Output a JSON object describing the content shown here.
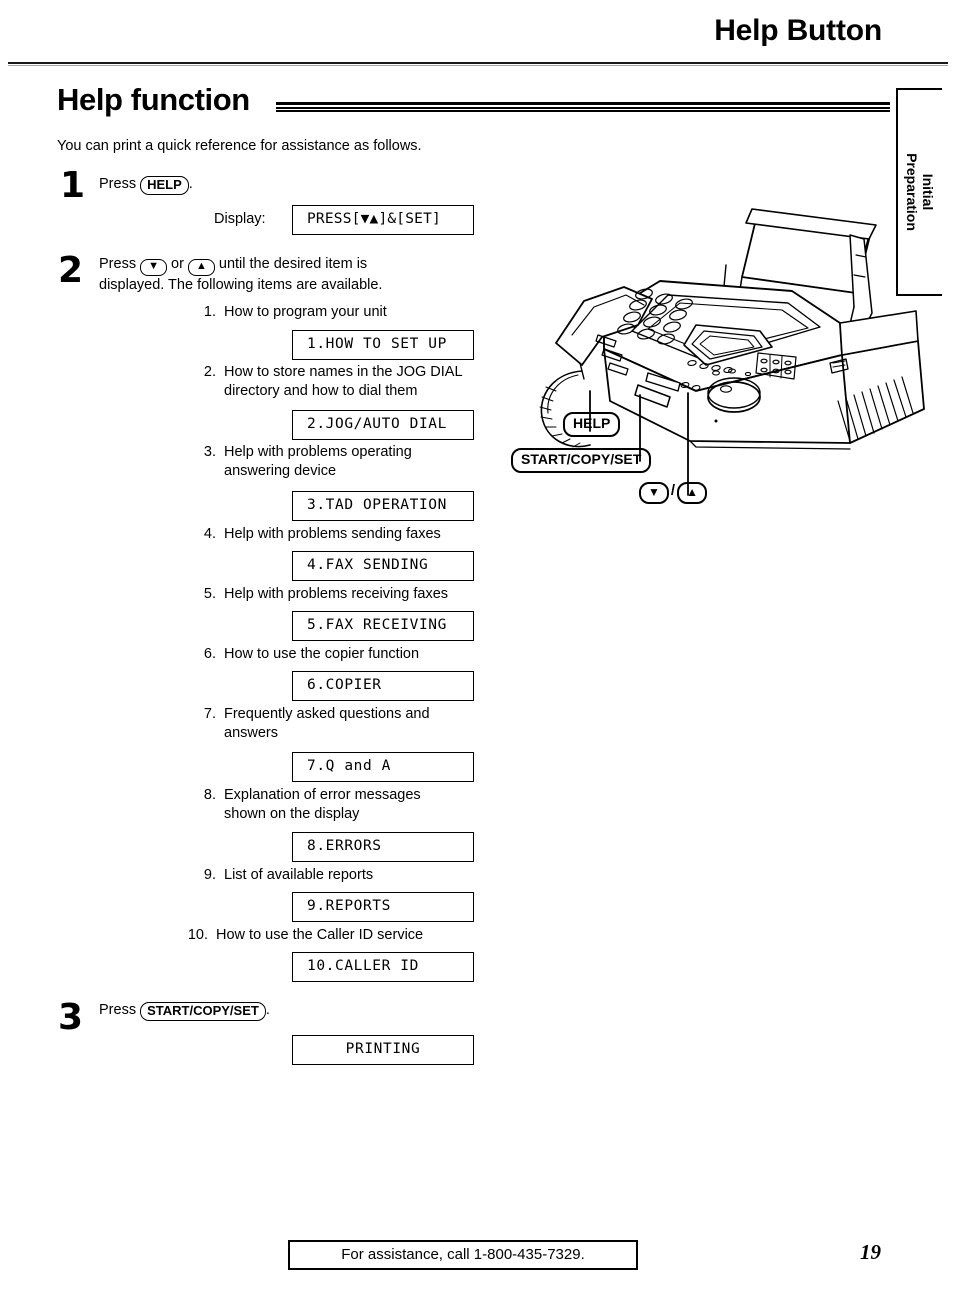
{
  "header": {
    "running_title": "Help Button",
    "section_title": "Help function"
  },
  "side_tab": {
    "line1": "Initial",
    "line2": "Preparation"
  },
  "intro": "You can print a quick reference for assistance as follows.",
  "steps": [
    {
      "number": "1",
      "text_before": "Press",
      "key": "HELP",
      "text_after": ".",
      "display_label": "Display:",
      "display_value": "PRESS[▼▲]&[SET]"
    },
    {
      "number": "2",
      "line1_a": "Press",
      "key_down": "▼",
      "line1_b": "or",
      "key_up": "▲",
      "line1_c": "until the desired item is",
      "line2": "displayed. The following items are available."
    },
    {
      "number": "3",
      "text_before": "Press",
      "key": "START/COPY/SET",
      "text_after": ".",
      "display_value": "PRINTING"
    }
  ],
  "items": [
    {
      "n": "1.",
      "desc": "How to program your unit",
      "lcd": "1.HOW TO SET UP"
    },
    {
      "n": "2.",
      "desc": "How to store names in the JOG DIAL directory and how to dial them",
      "lcd": "2.JOG/AUTO DIAL"
    },
    {
      "n": "3.",
      "desc": "Help with problems operating answering device",
      "lcd": "3.TAD OPERATION"
    },
    {
      "n": "4.",
      "desc": "Help with problems sending faxes",
      "lcd": "4.FAX SENDING"
    },
    {
      "n": "5.",
      "desc": "Help with problems receiving faxes",
      "lcd": "5.FAX RECEIVING"
    },
    {
      "n": "6.",
      "desc": "How to use the copier function",
      "lcd": "6.COPIER"
    },
    {
      "n": "7.",
      "desc": "Frequently asked questions and answers",
      "lcd": "7.Q and A"
    },
    {
      "n": "8.",
      "desc": "Explanation of error messages shown on the display",
      "lcd": "8.ERRORS"
    },
    {
      "n": "9.",
      "desc": "List of available reports",
      "lcd": "9.REPORTS"
    },
    {
      "n": "10.",
      "desc": "How to use the Caller ID service",
      "lcd": "10.CALLER ID"
    }
  ],
  "illustration": {
    "name": "fax-machine-line-drawing",
    "callouts": [
      {
        "label": "HELP"
      },
      {
        "label": "START/COPY/SET"
      },
      {
        "label_down": "▼",
        "separator": "/",
        "label_up": "▲"
      }
    ]
  },
  "footer": {
    "assistance": "For assistance, call 1-800-435-7329.",
    "page_number": "19"
  }
}
